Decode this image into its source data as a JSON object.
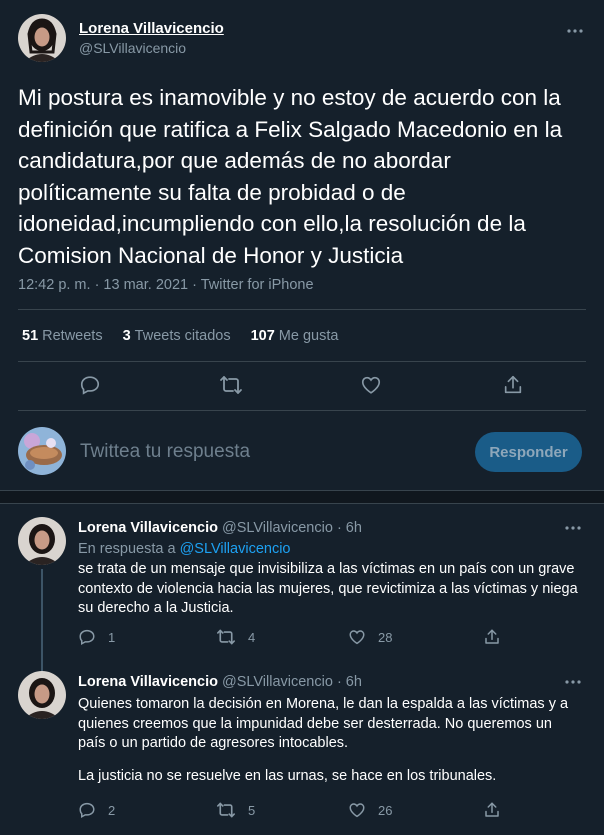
{
  "main_tweet": {
    "author_name": "Lorena Villavicencio",
    "author_handle": "@SLVillavicencio",
    "text": "Mi postura es inamovible y no estoy de acuerdo con la definición que ratifica a Felix Salgado Macedonio en la candidatura,por que además de no abordar políticamente su falta de probidad o de idoneidad,incumpliendo con ello,la resolución de la Comision Nacional de Honor y Justicia",
    "timestamp": "12:42 p. m. · 13 mar. 2021 · Twitter for iPhone",
    "stats": {
      "retweets_count": "51",
      "retweets_label": "Retweets",
      "quotes_count": "3",
      "quotes_label": "Tweets citados",
      "likes_count": "107",
      "likes_label": "Me gusta"
    }
  },
  "reply_composer": {
    "placeholder": "Twittea tu respuesta",
    "button_label": "Responder"
  },
  "replies": [
    {
      "author_name": "Lorena Villavicencio",
      "author_handle": "@SLVillavicencio",
      "time": "· 6h",
      "context_prefix": "En respuesta a",
      "context_handle": "@SLVillavicencio",
      "text": "se trata de un mensaje que invisibiliza a las víctimas en un país con un grave contexto de violencia hacia las mujeres, que revictimiza a las víctimas y niega su derecho a la Justicia.",
      "replies": "1",
      "retweets": "4",
      "likes": "28"
    },
    {
      "author_name": "Lorena Villavicencio",
      "author_handle": "@SLVillavicencio",
      "time": "· 6h",
      "text_p1": "Quienes tomaron la decisión en Morena, le dan la espalda a las víctimas y a quienes creemos que la impunidad  debe ser desterrada. No queremos un país o un partido de agresores intocables.",
      "text_p2": "La justicia no se resuelve en las urnas, se hace en los tribunales.",
      "replies": "2",
      "retweets": "5",
      "likes": "26"
    }
  ],
  "colors": {
    "background": "#15202b",
    "accent": "#1da1f2",
    "muted": "#8899a6",
    "border": "#38444d"
  },
  "icons": [
    "more-icon",
    "reply-icon",
    "retweet-icon",
    "like-icon",
    "share-icon"
  ]
}
